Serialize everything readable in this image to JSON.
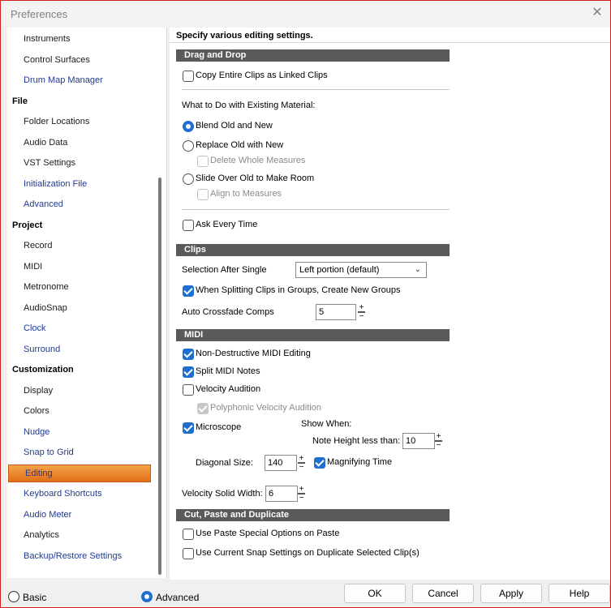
{
  "window": {
    "title": "Preferences",
    "close_glyph": "✕"
  },
  "sidebar": {
    "items": [
      {
        "label": "Instruments",
        "kind": "child"
      },
      {
        "label": "Control Surfaces",
        "kind": "child"
      },
      {
        "label": "Drum Map Manager",
        "kind": "link"
      },
      {
        "label": "File",
        "kind": "header"
      },
      {
        "label": "Folder Locations",
        "kind": "child"
      },
      {
        "label": "Audio Data",
        "kind": "child"
      },
      {
        "label": "VST Settings",
        "kind": "child"
      },
      {
        "label": "Initialization File",
        "kind": "link"
      },
      {
        "label": "Advanced",
        "kind": "link"
      },
      {
        "label": "Project",
        "kind": "header"
      },
      {
        "label": "Record",
        "kind": "child"
      },
      {
        "label": "MIDI",
        "kind": "child"
      },
      {
        "label": "Metronome",
        "kind": "child"
      },
      {
        "label": "AudioSnap",
        "kind": "child"
      },
      {
        "label": "Clock",
        "kind": "link"
      },
      {
        "label": "Surround",
        "kind": "link"
      },
      {
        "label": "Customization",
        "kind": "header"
      },
      {
        "label": "Display",
        "kind": "child"
      },
      {
        "label": "Colors",
        "kind": "child"
      },
      {
        "label": "Nudge",
        "kind": "link"
      },
      {
        "label": "Snap to Grid",
        "kind": "link"
      },
      {
        "label": "Editing",
        "kind": "selected"
      },
      {
        "label": "Keyboard Shortcuts",
        "kind": "link"
      },
      {
        "label": "Audio Meter",
        "kind": "link"
      },
      {
        "label": "Analytics",
        "kind": "child"
      },
      {
        "label": "Backup/Restore Settings",
        "kind": "link"
      }
    ]
  },
  "content": {
    "heading": "Specify various editing settings.",
    "drag_drop": {
      "section": "Drag and Drop",
      "copy_linked": "Copy Entire Clips as Linked Clips",
      "existing_label": "What to Do with Existing Material:",
      "blend": "Blend Old and New",
      "replace": "Replace Old with New",
      "delete_whole": "Delete Whole Measures",
      "slide": "Slide Over Old to Make Room",
      "align": "Align to Measures",
      "ask": "Ask Every Time"
    },
    "clips": {
      "section": "Clips",
      "selection_label": "Selection After Single",
      "selection_value": "Left portion (default)",
      "split_groups": "When Splitting Clips in Groups, Create New Groups",
      "crossfade_label": "Auto Crossfade Comps",
      "crossfade_value": "5"
    },
    "midi": {
      "section": "MIDI",
      "non_destructive": "Non-Destructive MIDI Editing",
      "split_notes": "Split MIDI Notes",
      "velocity_audition": "Velocity Audition",
      "polyphonic": "Polyphonic Velocity Audition",
      "microscope": "Microscope",
      "show_when": "Show When:",
      "note_height_label": "Note Height less than:",
      "note_height_value": "10",
      "diagonal_label": "Diagonal Size:",
      "diagonal_value": "140",
      "magnifying": "Magnifying Time",
      "velocity_width_label": "Velocity Solid Width:",
      "velocity_width_value": "6"
    },
    "cut_paste": {
      "section": "Cut, Paste and Duplicate",
      "paste_special": "Use Paste Special Options on Paste",
      "snap_duplicate": "Use Current Snap Settings on Duplicate Selected Clip(s)"
    }
  },
  "footer": {
    "basic": "Basic",
    "advanced": "Advanced",
    "ok": "OK",
    "cancel": "Cancel",
    "apply": "Apply",
    "help": "Help"
  },
  "colors": {
    "accent": "#1f6fd1",
    "selected_item": "#e8832e",
    "section_header": "#5a5a5a"
  }
}
